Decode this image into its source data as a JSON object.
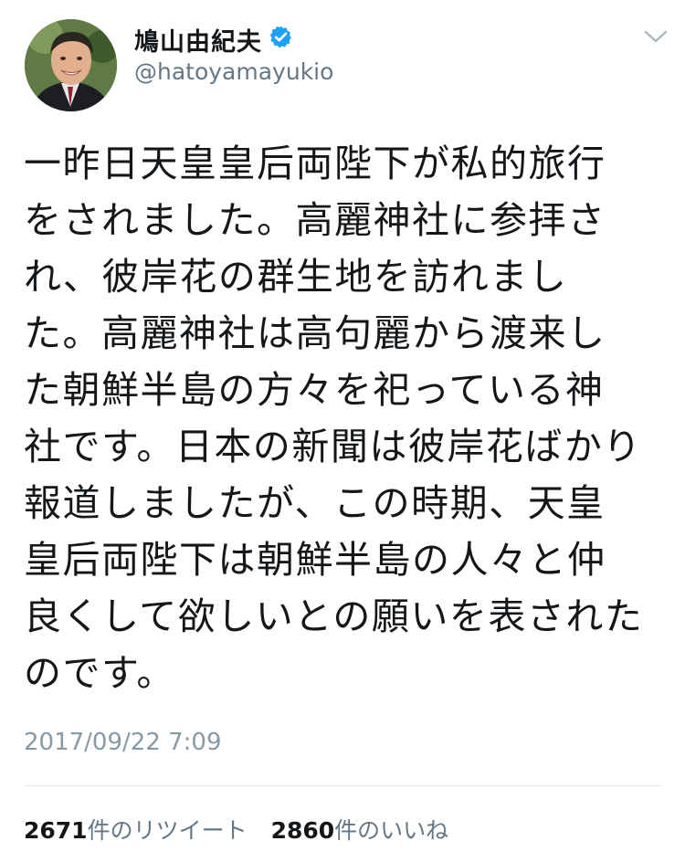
{
  "author": {
    "display_name": "鳩山由紀夫",
    "handle": "@hatoyamayukio",
    "avatar_icon": "profile-photo",
    "verified_icon": "verified-badge-icon",
    "verified_color": "#1da1f2"
  },
  "menu": {
    "icon": "chevron-down-icon"
  },
  "tweet": {
    "lines": [
      "一昨日天皇皇后両陛下が私的旅行",
      "をされました。高麗神社に参拝さ",
      "れ、彼岸花の群生地を訪れまし",
      "た。高麗神社は高句麗から渡来し",
      "た朝鮮半島の方々を祀っている神",
      "社です。日本の新聞は彼岸花ばかり",
      "報道しましたが、この時期、天皇",
      "皇后両陛下は朝鮮半島の人々と仲",
      "良くして欲しいとの願いを表された",
      "のです。"
    ],
    "timestamp": "2017/09/22 7:09"
  },
  "stats": {
    "retweets": {
      "count": "2671",
      "label": "件のリツイート"
    },
    "likes": {
      "count": "2860",
      "label": "件のいいね"
    }
  }
}
